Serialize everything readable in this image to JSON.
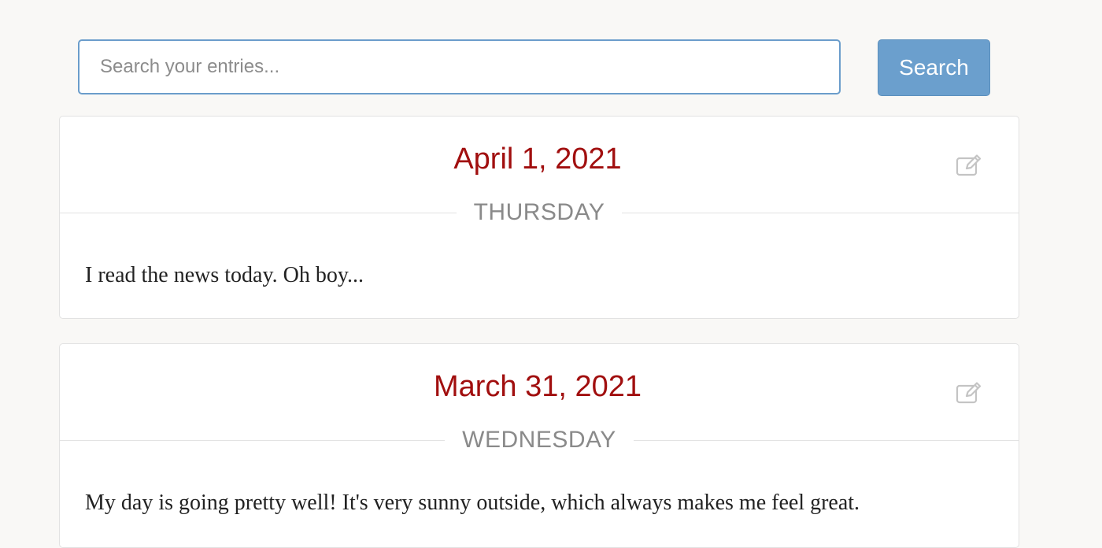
{
  "search": {
    "placeholder": "Search your entries...",
    "value": "",
    "button_label": "Search"
  },
  "entries": [
    {
      "date": "April 1, 2021",
      "weekday": "THURSDAY",
      "body": "I read the news today. Oh boy...",
      "edit_icon": "edit-icon"
    },
    {
      "date": "March 31, 2021",
      "weekday": "WEDNESDAY",
      "body": "My day is going pretty well! It's very sunny outside, which always makes me feel great.",
      "edit_icon": "edit-icon"
    }
  ],
  "colors": {
    "accent": "#6b9fcd",
    "date_red": "#a10f0f",
    "weekday_gray": "#8a8a8a",
    "background": "#f9f8f6"
  }
}
